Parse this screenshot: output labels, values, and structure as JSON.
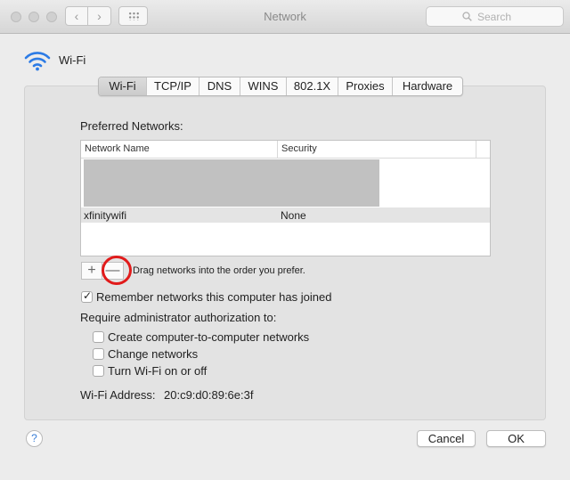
{
  "window": {
    "title": "Network"
  },
  "search": {
    "placeholder": "Search",
    "icon": "search-icon"
  },
  "header": {
    "label": "Wi-Fi",
    "icon": "wifi-icon"
  },
  "tabs": [
    {
      "label": "Wi-Fi",
      "active": true
    },
    {
      "label": "TCP/IP",
      "active": false
    },
    {
      "label": "DNS",
      "active": false
    },
    {
      "label": "WINS",
      "active": false
    },
    {
      "label": "802.1X",
      "active": false
    },
    {
      "label": "Proxies",
      "active": false
    },
    {
      "label": "Hardware",
      "active": false
    }
  ],
  "preferred": {
    "label": "Preferred Networks:",
    "columns": {
      "name": "Network Name",
      "security": "Security"
    },
    "rows": [
      {
        "name": "xfinitywifi",
        "security": "None"
      }
    ],
    "add_symbol": "+",
    "remove_symbol": "—",
    "hint": "Drag networks into the order you prefer."
  },
  "remember": {
    "label": "Remember networks this computer has joined",
    "checked": true
  },
  "require": {
    "label": "Require administrator authorization to:",
    "options": [
      {
        "label": "Create computer-to-computer networks",
        "checked": false
      },
      {
        "label": "Change networks",
        "checked": false
      },
      {
        "label": "Turn Wi-Fi on or off",
        "checked": false
      }
    ]
  },
  "address": {
    "label": "Wi-Fi Address:",
    "value": "20:c9:d0:89:6e:3f"
  },
  "footer": {
    "help": "?",
    "cancel": "Cancel",
    "ok": "OK"
  },
  "colors": {
    "annotation": "#e11b1b",
    "wifi": "#2c7be5",
    "help": "#3b7fd6"
  }
}
